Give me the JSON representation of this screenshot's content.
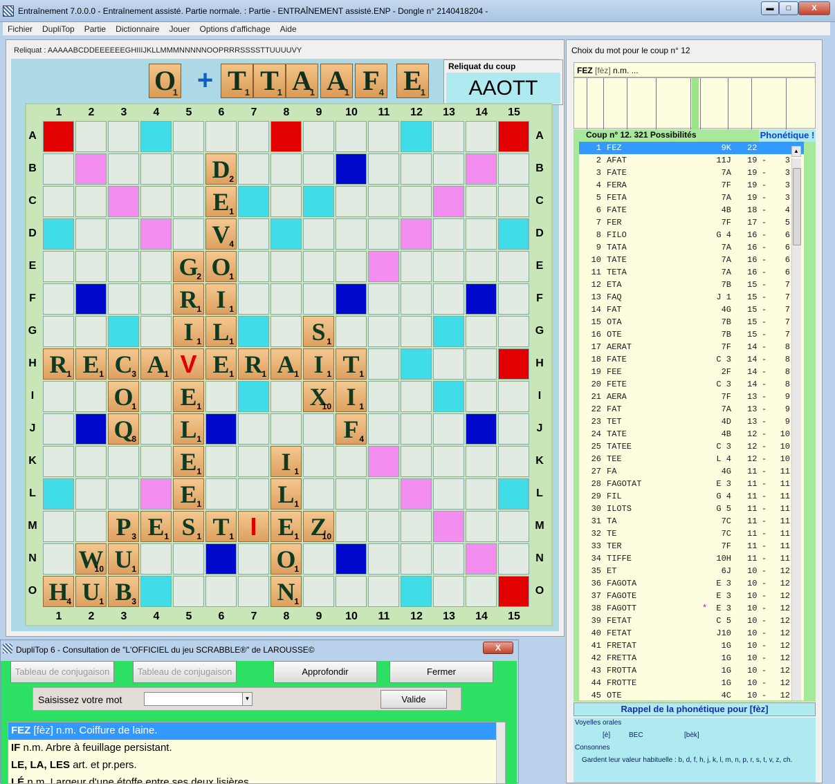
{
  "window": {
    "title": "Entraînement 7.0.0.0 - Entraînement assisté. Partie normale. : Partie - ENTRAÎNEMENT assisté.ENP - Dongle n° 2140418204 -",
    "min": "▬",
    "max": "□",
    "close": "X"
  },
  "menu": [
    "Fichier",
    "DupliTop",
    "Partie",
    "Dictionnaire",
    "Jouer",
    "Options d'affichage",
    "Aide"
  ],
  "reliquat": "Reliquat : AAAAABCDDEEEEEEGHIIIJKLLMMMNNNNNOOPRRRSSSSTTUUUUVY",
  "rack": {
    "tiles": [
      {
        "l": "O",
        "v": "1"
      },
      {
        "l": "T",
        "v": "1"
      },
      {
        "l": "T",
        "v": "1"
      },
      {
        "l": "A",
        "v": "1"
      },
      {
        "l": "A",
        "v": "1"
      },
      {
        "l": "F",
        "v": "4"
      },
      {
        "l": "E",
        "v": "1"
      }
    ],
    "separator": "+"
  },
  "reliquat_coup": {
    "title": "Reliquat du coup",
    "value": "AAOTT"
  },
  "board": {
    "cols": [
      "1",
      "2",
      "3",
      "4",
      "5",
      "6",
      "7",
      "8",
      "9",
      "10",
      "11",
      "12",
      "13",
      "14",
      "15"
    ],
    "rows": [
      "A",
      "B",
      "C",
      "D",
      "E",
      "F",
      "G",
      "H",
      "I",
      "J",
      "K",
      "L",
      "M",
      "N",
      "O"
    ],
    "tiles": [
      {
        "r": 1,
        "c": 5,
        "l": "D",
        "v": "2"
      },
      {
        "r": 2,
        "c": 5,
        "l": "E",
        "v": "1"
      },
      {
        "r": 3,
        "c": 5,
        "l": "V",
        "v": "4"
      },
      {
        "r": 4,
        "c": 4,
        "l": "G",
        "v": "2"
      },
      {
        "r": 4,
        "c": 5,
        "l": "O",
        "v": "1"
      },
      {
        "r": 5,
        "c": 4,
        "l": "R",
        "v": "1"
      },
      {
        "r": 5,
        "c": 5,
        "l": "I",
        "v": "1"
      },
      {
        "r": 6,
        "c": 4,
        "l": "I",
        "v": "1"
      },
      {
        "r": 6,
        "c": 5,
        "l": "L",
        "v": "1"
      },
      {
        "r": 6,
        "c": 8,
        "l": "S",
        "v": "1"
      },
      {
        "r": 7,
        "c": 0,
        "l": "R",
        "v": "1"
      },
      {
        "r": 7,
        "c": 1,
        "l": "E",
        "v": "1"
      },
      {
        "r": 7,
        "c": 2,
        "l": "C",
        "v": "3"
      },
      {
        "r": 7,
        "c": 3,
        "l": "A",
        "v": "1"
      },
      {
        "r": 7,
        "c": 4,
        "l": "V",
        "v": "",
        "j": true
      },
      {
        "r": 7,
        "c": 5,
        "l": "E",
        "v": "1"
      },
      {
        "r": 7,
        "c": 6,
        "l": "R",
        "v": "1"
      },
      {
        "r": 7,
        "c": 7,
        "l": "A",
        "v": "1"
      },
      {
        "r": 7,
        "c": 8,
        "l": "I",
        "v": "1"
      },
      {
        "r": 7,
        "c": 9,
        "l": "T",
        "v": "1"
      },
      {
        "r": 8,
        "c": 2,
        "l": "O",
        "v": "1"
      },
      {
        "r": 8,
        "c": 4,
        "l": "E",
        "v": "1"
      },
      {
        "r": 8,
        "c": 8,
        "l": "X",
        "v": "10"
      },
      {
        "r": 8,
        "c": 9,
        "l": "I",
        "v": "1"
      },
      {
        "r": 9,
        "c": 2,
        "l": "Q",
        "v": "8"
      },
      {
        "r": 9,
        "c": 4,
        "l": "L",
        "v": "1"
      },
      {
        "r": 9,
        "c": 9,
        "l": "F",
        "v": "4"
      },
      {
        "r": 10,
        "c": 4,
        "l": "E",
        "v": "1"
      },
      {
        "r": 10,
        "c": 7,
        "l": "I",
        "v": "1"
      },
      {
        "r": 11,
        "c": 4,
        "l": "E",
        "v": "1"
      },
      {
        "r": 11,
        "c": 7,
        "l": "L",
        "v": "1"
      },
      {
        "r": 12,
        "c": 2,
        "l": "P",
        "v": "3"
      },
      {
        "r": 12,
        "c": 3,
        "l": "E",
        "v": "1"
      },
      {
        "r": 12,
        "c": 4,
        "l": "S",
        "v": "1"
      },
      {
        "r": 12,
        "c": 5,
        "l": "T",
        "v": "1"
      },
      {
        "r": 12,
        "c": 6,
        "l": "I",
        "v": "",
        "j": true
      },
      {
        "r": 12,
        "c": 7,
        "l": "E",
        "v": "1"
      },
      {
        "r": 12,
        "c": 8,
        "l": "Z",
        "v": "10"
      },
      {
        "r": 13,
        "c": 1,
        "l": "W",
        "v": "10"
      },
      {
        "r": 13,
        "c": 2,
        "l": "U",
        "v": "1"
      },
      {
        "r": 13,
        "c": 7,
        "l": "O",
        "v": "1"
      },
      {
        "r": 14,
        "c": 0,
        "l": "H",
        "v": "4"
      },
      {
        "r": 14,
        "c": 1,
        "l": "U",
        "v": "1"
      },
      {
        "r": 14,
        "c": 2,
        "l": "B",
        "v": "3"
      },
      {
        "r": 14,
        "c": 7,
        "l": "N",
        "v": "1"
      }
    ]
  },
  "right": {
    "title": "Choix du mot pour le coup n° 12",
    "def": {
      "word": "FEZ",
      "phon": "[fèz]",
      "rest": "n.m. ..."
    },
    "coup_header": "Coup n° 12.    321 Possibilités",
    "phon_button": "Phonétique !",
    "moves": [
      [
        "1",
        "FEZ",
        "9K",
        "22",
        "",
        ""
      ],
      [
        "2",
        "AFAT",
        "11J",
        "19",
        "-",
        "3"
      ],
      [
        "3",
        "FATE",
        "7A",
        "19",
        "-",
        "3"
      ],
      [
        "4",
        "FERA",
        "7F",
        "19",
        "-",
        "3"
      ],
      [
        "5",
        "FETA",
        "7A",
        "19",
        "-",
        "3"
      ],
      [
        "6",
        "FATE",
        "4B",
        "18",
        "-",
        "4"
      ],
      [
        "7",
        "FER",
        "7F",
        "17",
        "-",
        "5"
      ],
      [
        "8",
        "FILO",
        "G 4",
        "16",
        "-",
        "6"
      ],
      [
        "9",
        "TATA",
        "7A",
        "16",
        "-",
        "6"
      ],
      [
        "10",
        "TATE",
        "7A",
        "16",
        "-",
        "6"
      ],
      [
        "11",
        "TETA",
        "7A",
        "16",
        "-",
        "6"
      ],
      [
        "12",
        "ETA",
        "7B",
        "15",
        "-",
        "7"
      ],
      [
        "13",
        "FAQ",
        "J 1",
        "15",
        "-",
        "7"
      ],
      [
        "14",
        "FAT",
        "4G",
        "15",
        "-",
        "7"
      ],
      [
        "15",
        "OTA",
        "7B",
        "15",
        "-",
        "7"
      ],
      [
        "16",
        "OTE",
        "7B",
        "15",
        "-",
        "7"
      ],
      [
        "17",
        "AERAT",
        "7F",
        "14",
        "-",
        "8"
      ],
      [
        "18",
        "FATE",
        "C 3",
        "14",
        "-",
        "8"
      ],
      [
        "19",
        "FEE",
        "2F",
        "14",
        "-",
        "8"
      ],
      [
        "20",
        "FETE",
        "C 3",
        "14",
        "-",
        "8"
      ],
      [
        "21",
        "AERA",
        "7F",
        "13",
        "-",
        "9"
      ],
      [
        "22",
        "FAT",
        "7A",
        "13",
        "-",
        "9"
      ],
      [
        "23",
        "TET",
        "4D",
        "13",
        "-",
        "9"
      ],
      [
        "24",
        "TATE",
        "4B",
        "12",
        "-",
        "10"
      ],
      [
        "25",
        "TATEE",
        "C 3",
        "12",
        "-",
        "10"
      ],
      [
        "26",
        "TEE",
        "L 4",
        "12",
        "-",
        "10"
      ],
      [
        "27",
        "FA",
        "4G",
        "11",
        "-",
        "11"
      ],
      [
        "28",
        "FAGOTAT",
        "E 3",
        "11",
        "-",
        "11"
      ],
      [
        "29",
        "FIL",
        "G 4",
        "11",
        "-",
        "11"
      ],
      [
        "30",
        "ILOTS",
        "G 5",
        "11",
        "-",
        "11"
      ],
      [
        "31",
        "TA",
        "7C",
        "11",
        "-",
        "11"
      ],
      [
        "32",
        "TE",
        "7C",
        "11",
        "-",
        "11"
      ],
      [
        "33",
        "TER",
        "7F",
        "11",
        "-",
        "11"
      ],
      [
        "34",
        "TIFFE",
        "10H",
        "11",
        "-",
        "11"
      ],
      [
        "35",
        "ET",
        "6J",
        "10",
        "-",
        "12"
      ],
      [
        "36",
        "FAGOTA",
        "E 3",
        "10",
        "-",
        "12"
      ],
      [
        "37",
        "FAGOTE",
        "E 3",
        "10",
        "-",
        "12"
      ],
      [
        "38",
        "FAGOTT",
        "E 3",
        "10",
        "-",
        "12"
      ],
      [
        "39",
        "FETAT",
        "C 5",
        "10",
        "-",
        "12"
      ],
      [
        "40",
        "FETAT",
        "J10",
        "10",
        "-",
        "12"
      ],
      [
        "41",
        "FRETAT",
        "1G",
        "10",
        "-",
        "12"
      ],
      [
        "42",
        "FRETTA",
        "1G",
        "10",
        "-",
        "12"
      ],
      [
        "43",
        "FROTTA",
        "1G",
        "10",
        "-",
        "12"
      ],
      [
        "44",
        "FROTTE",
        "1G",
        "10",
        "-",
        "12"
      ],
      [
        "45",
        "OTE",
        "4C",
        "10",
        "-",
        "12"
      ]
    ],
    "star": "*",
    "rappel": "Rappel de la phonétique pour [fèz]",
    "voyelles": "Voyelles orales",
    "ex_phon": "[è]",
    "ex_word": "BEC",
    "ex_pron": "[bèk]",
    "consonnes": "Consonnes",
    "gardent": "Gardent leur valeur habituelle : b, d, f, h, j, k, l, m, n, p, r, s, t, v, z, ch."
  },
  "dict": {
    "title": "DupliTop 6 - Consultation de \"L'OFFICIEL du jeu SCRABBLE®\" de LAROUSSE©",
    "close": "X",
    "btn_conj1": "Tableau de conjugaison",
    "btn_conj2": "Tableau de conjugaison",
    "btn_approf": "Approfondir",
    "btn_fermer": "Fermer",
    "search_label": "Saisissez votre mot",
    "search_value": "",
    "valide": "Valide",
    "lines": [
      {
        "w": "FEZ",
        "rest": "[fèz] n.m. Coiffure de laine."
      },
      {
        "w": "IF",
        "rest": "n.m. Arbre à feuillage persistant."
      },
      {
        "w": "LE, LA, LES",
        "rest": "art. et pr.pers."
      },
      {
        "w": "LÉ",
        "rest": "n.m. Largeur d'une étoffe entre ses deux lisières."
      }
    ]
  }
}
